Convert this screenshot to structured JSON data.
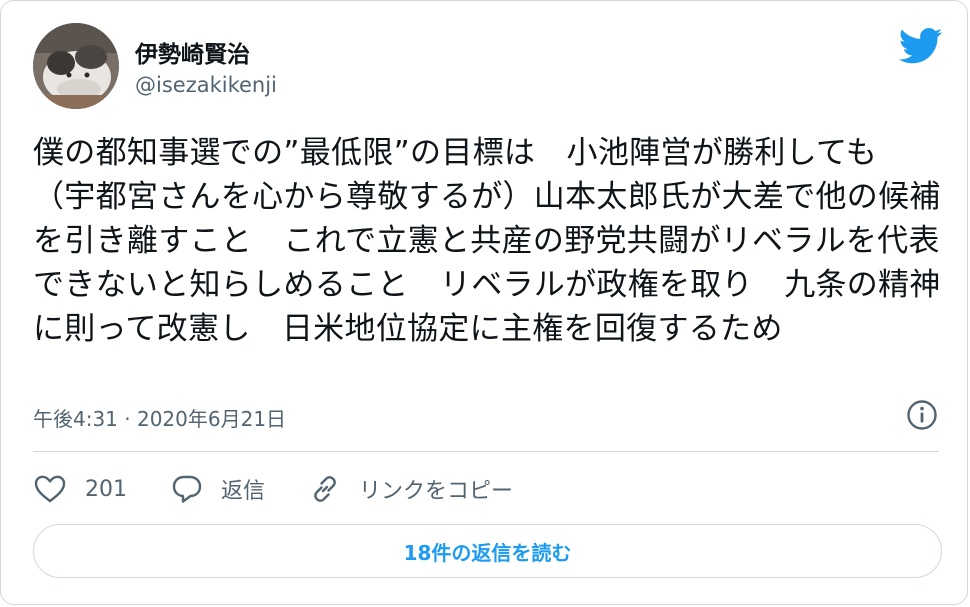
{
  "author": {
    "display_name": "伊勢崎賢治",
    "handle": "@isezakikenji"
  },
  "tweet": {
    "text": "僕の都知事選での”最低限”の目標は　小池陣営が勝利しても　（宇都宮さんを心から尊敬するが）山本太郎氏が大差で他の候補を引き離すこと　これで立憲と共産の野党共闘がリベラルを代表できないと知らしめること　リベラルが政権を取り　九条の精神に則って改憲し　日米地位協定に主権を回復するため",
    "timestamp": "午後4:31 · 2020年6月21日"
  },
  "actions": {
    "like_count": "201",
    "reply_label": "返信",
    "copy_link_label": "リンクをコピー"
  },
  "read_replies_label": "18件の返信を読む",
  "colors": {
    "accent": "#1d9bf0",
    "secondary_text": "#536471",
    "border": "#cfd9de"
  },
  "icons": [
    "twitter-bird-icon",
    "info-icon",
    "heart-icon",
    "reply-icon",
    "link-icon"
  ]
}
